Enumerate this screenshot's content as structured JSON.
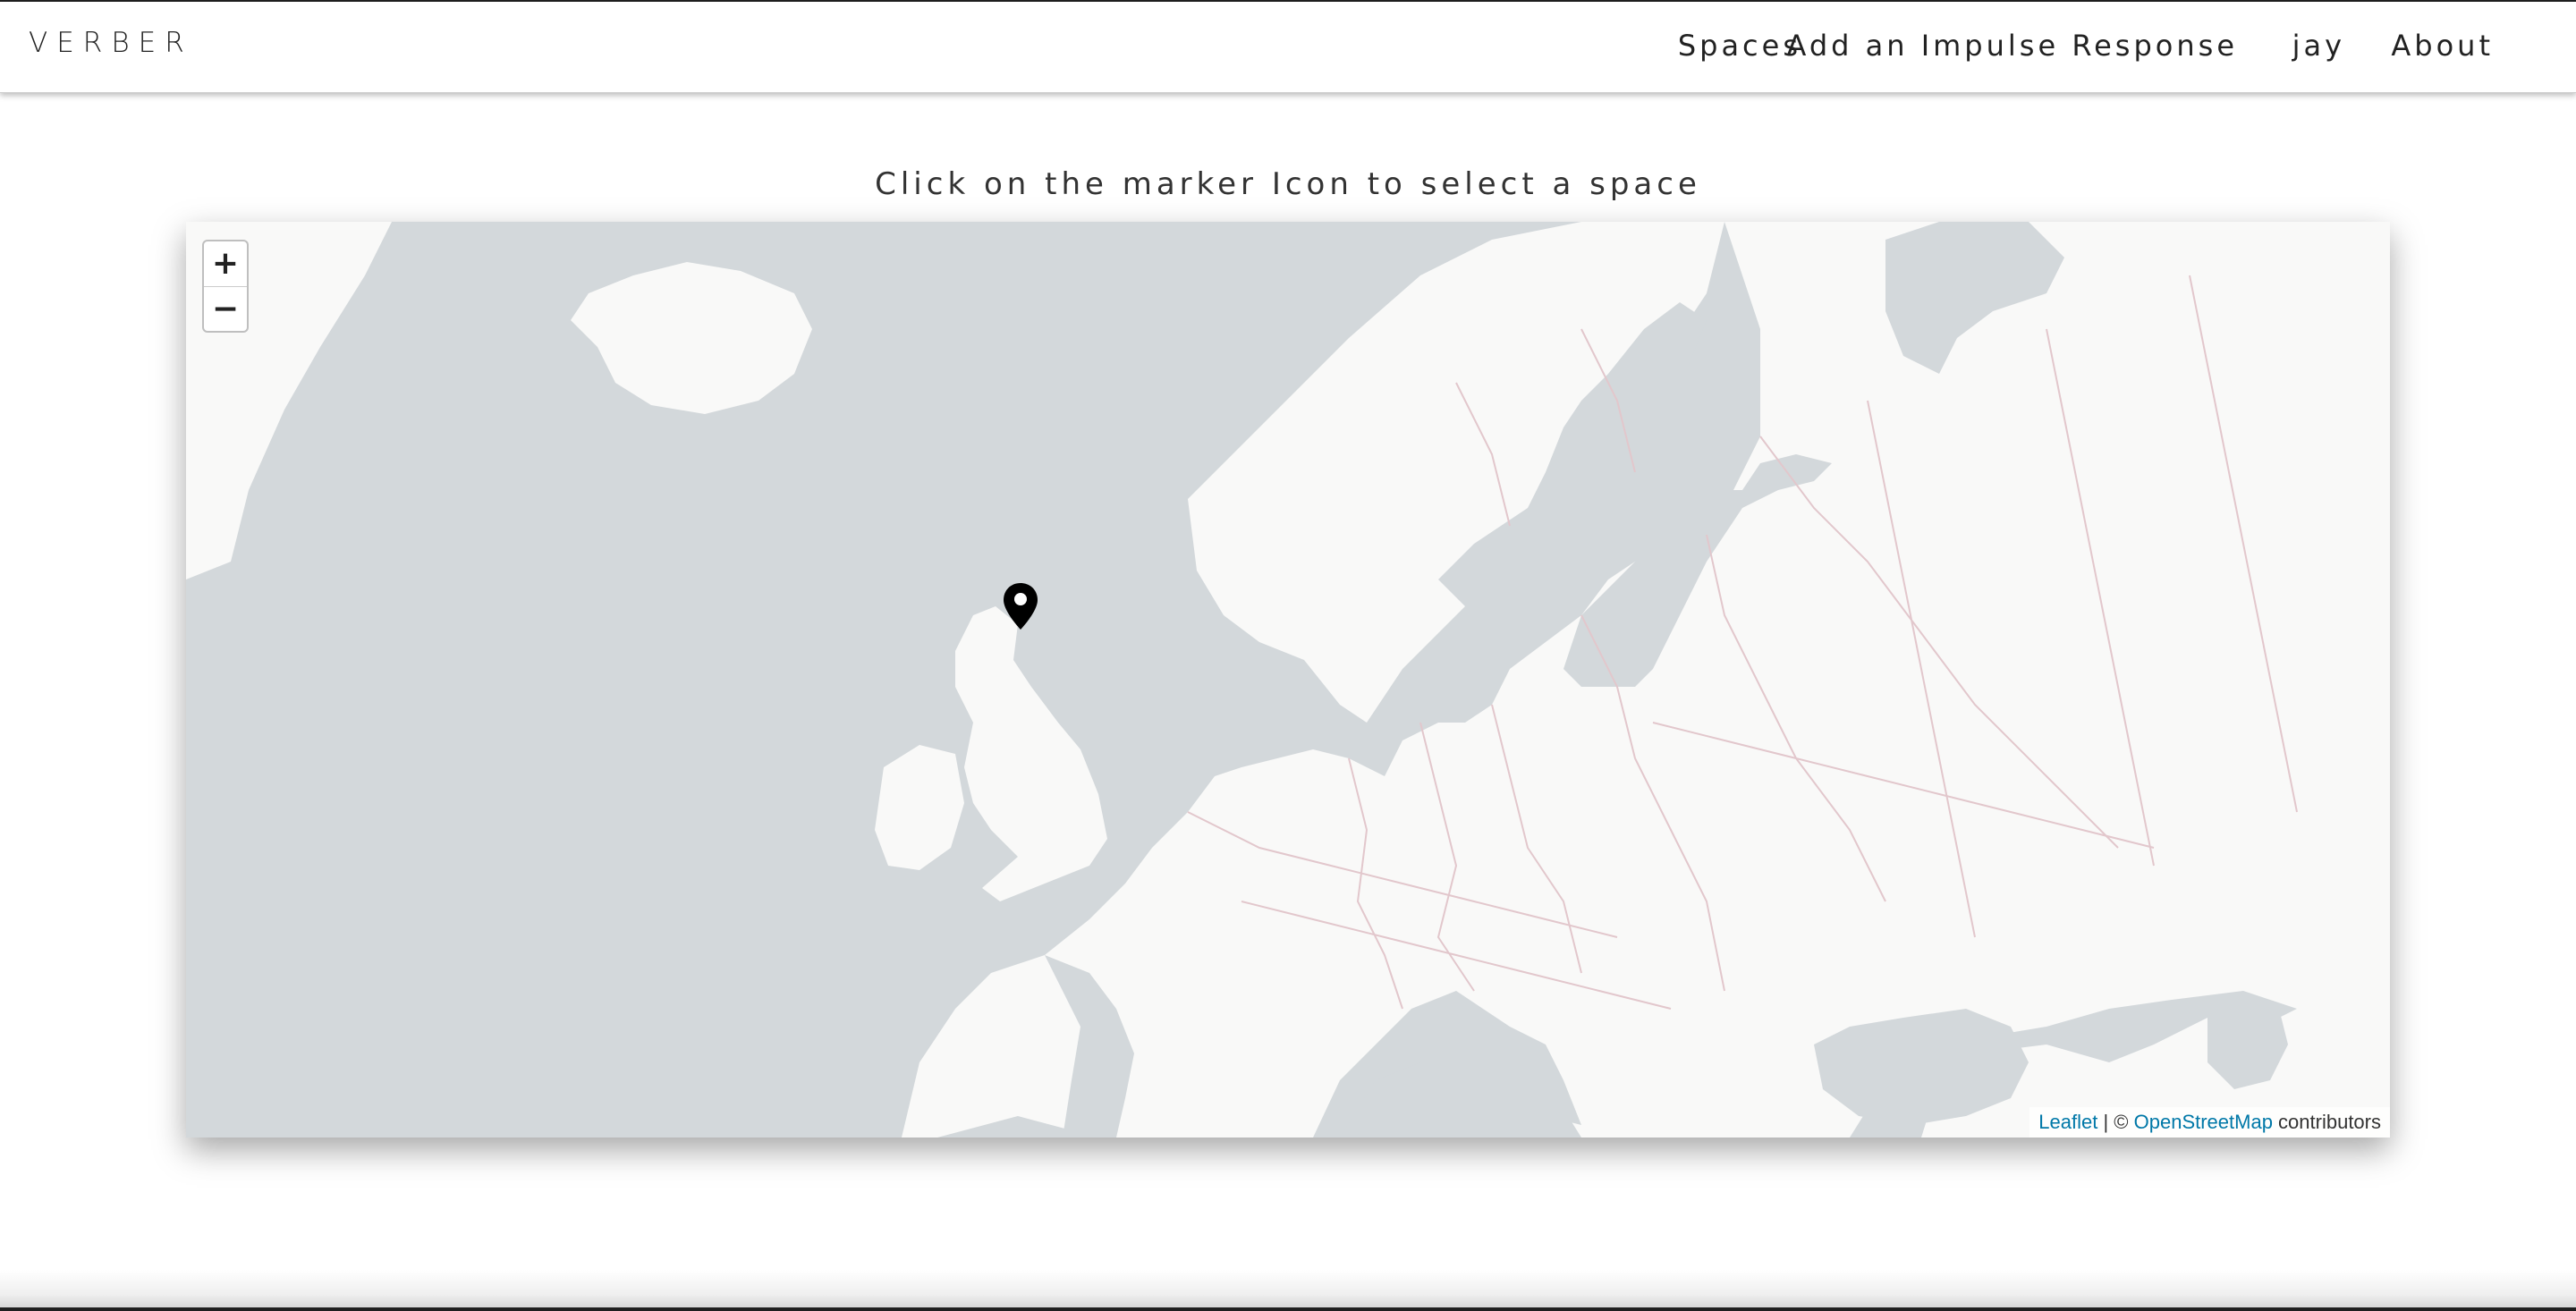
{
  "navbar": {
    "brand": "VERBER",
    "links": [
      "Spaces",
      "Add an Impulse Response",
      "jay",
      "About"
    ]
  },
  "main": {
    "instruction": "Click on the marker Icon to select a space"
  },
  "map": {
    "zoom_in_label": "+",
    "zoom_out_label": "−",
    "attribution": {
      "leaflet": "Leaflet",
      "separator": " | © ",
      "osm": "OpenStreetMap",
      "suffix": " contributors"
    },
    "colors": {
      "water": "#d3d8db",
      "land": "#f9f9f8",
      "border": "#e2c7cc",
      "link": "#0078a8"
    },
    "marker_icon": "map-pin-icon"
  }
}
